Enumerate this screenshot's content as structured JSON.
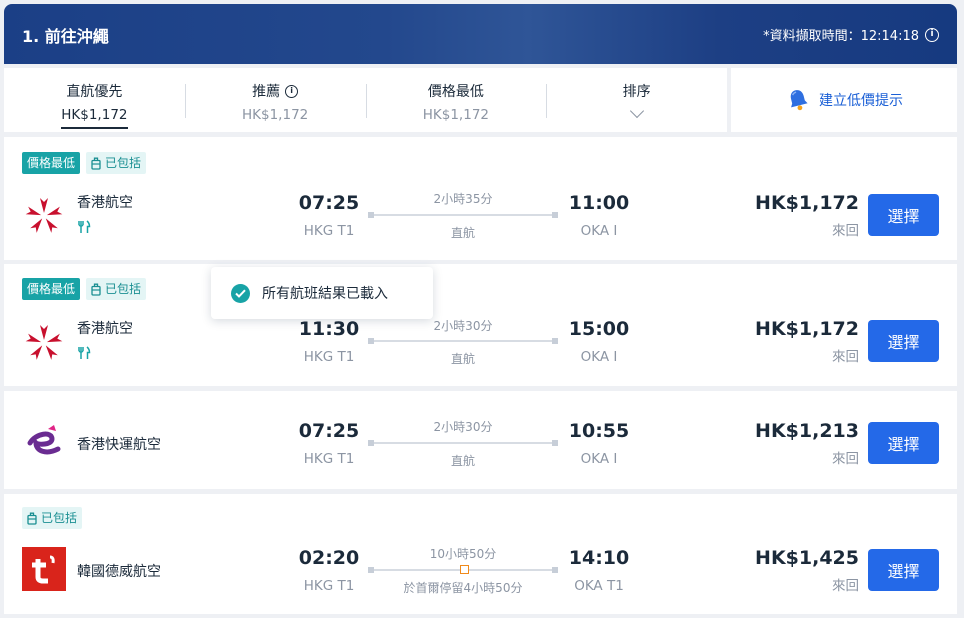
{
  "header": {
    "title": "1. 前往沖繩",
    "fetch_time": "*資料擷取時間：12:14:18"
  },
  "sort_tabs": [
    {
      "label": "直航優先",
      "value": "HK$1,172",
      "active": true
    },
    {
      "label": "推薦",
      "value": "HK$1,172",
      "info": true
    },
    {
      "label": "價格最低",
      "value": "HK$1,172"
    },
    {
      "label": "排序",
      "dropdown": true
    }
  ],
  "price_alert_label": "建立低價提示",
  "toast": "所有航班結果已載入",
  "flights": [
    {
      "tags": [
        "價格最低",
        "已包括"
      ],
      "airline": "香港航空",
      "meal": true,
      "depart_time": "07:25",
      "depart_airport": "HKG T1",
      "duration": "2小時35分",
      "stop_info": "直航",
      "arrive_time": "11:00",
      "arrive_airport": "OKA I",
      "price": "HK$1,172",
      "trip_type": "來回",
      "button": "選擇"
    },
    {
      "tags": [
        "價格最低",
        "已包括"
      ],
      "airline": "香港航空",
      "meal": true,
      "depart_time": "11:30",
      "depart_airport": "HKG T1",
      "duration": "2小時30分",
      "stop_info": "直航",
      "arrive_time": "15:00",
      "arrive_airport": "OKA I",
      "price": "HK$1,172",
      "trip_type": "來回",
      "button": "選擇"
    },
    {
      "tags": [],
      "airline": "香港快運航空",
      "meal": false,
      "depart_time": "07:25",
      "depart_airport": "HKG T1",
      "duration": "2小時30分",
      "stop_info": "直航",
      "arrive_time": "10:55",
      "arrive_airport": "OKA I",
      "price": "HK$1,213",
      "trip_type": "來回",
      "button": "選擇"
    },
    {
      "tags": [
        "已包括"
      ],
      "airline": "韓國德威航空",
      "meal": false,
      "depart_time": "02:20",
      "depart_airport": "HKG T1",
      "duration": "10小時50分",
      "stop_info": "於首爾停留4小時50分",
      "arrive_time": "14:10",
      "arrive_airport": "OKA T1",
      "price": "HK$1,425",
      "trip_type": "來回",
      "button": "選擇"
    }
  ],
  "colors": {
    "header": "#1b3f86",
    "accent_blue": "#2469e8",
    "teal_tag": "#18a3a6",
    "hk_airlines_red": "#c8102e",
    "hk_express_purple": "#6a2c91",
    "tway_red": "#d9241b"
  }
}
